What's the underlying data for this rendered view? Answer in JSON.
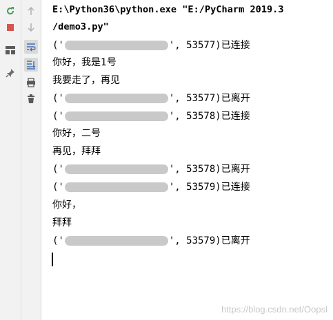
{
  "toolbar": {
    "icons": [
      "rerun-icon",
      "stop-icon",
      "restore-layout-icon",
      "pin-icon"
    ]
  },
  "toolbar2": {
    "icons": [
      "up-arrow-icon",
      "down-arrow-icon",
      "soft-wrap-icon",
      "scroll-to-end-icon",
      "print-icon",
      "trash-icon"
    ]
  },
  "console": {
    "command_line1": "E:\\Python36\\python.exe \"E:/PyCharm 2019.3",
    "command_line2": " /demo3.py\"",
    "lines": [
      {
        "prefix": "('",
        "suffix": "', 53577)",
        "cn": "已连接"
      },
      {
        "text": "你好，我是1号"
      },
      {
        "text": "我要走了，再见"
      },
      {
        "prefix": "('",
        "suffix": "', 53577)",
        "cn": "已离开"
      },
      {
        "prefix": "('",
        "suffix": "', 53578)",
        "cn": "已连接"
      },
      {
        "text": "你好，二号"
      },
      {
        "text": "再见，拜拜"
      },
      {
        "prefix": "('",
        "suffix": "', 53578)",
        "cn": "已离开"
      },
      {
        "prefix": "('",
        "suffix": "', 53579)",
        "cn": "已连接"
      },
      {
        "text": "你好，"
      },
      {
        "text": "拜拜"
      },
      {
        "prefix": "('",
        "suffix": "', 53579)",
        "cn": "已离开"
      }
    ]
  },
  "watermark": "https://blog.csdn.net/Oopsl",
  "colors": {
    "rerun": "#4e9a5a",
    "stop": "#d9534f",
    "icon_gray": "#6e6e6e",
    "accent_blue": "#3d6fb6"
  }
}
